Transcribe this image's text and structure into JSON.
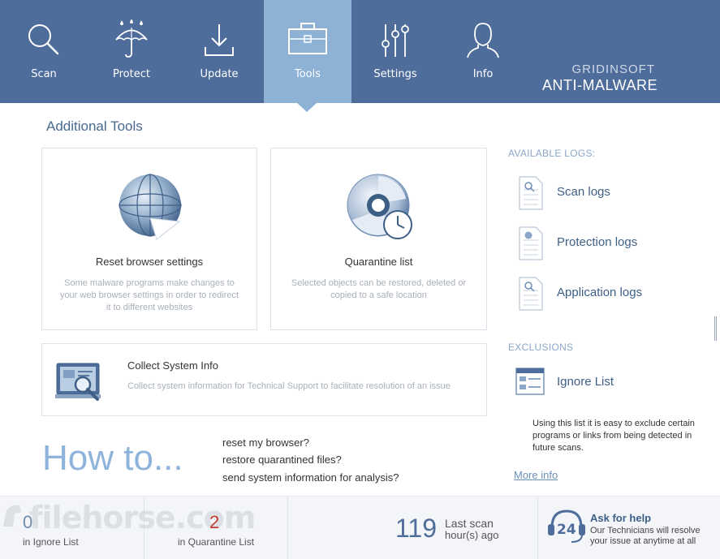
{
  "nav": {
    "items": [
      {
        "label": "Scan",
        "icon": "search-icon"
      },
      {
        "label": "Protect",
        "icon": "umbrella-icon"
      },
      {
        "label": "Update",
        "icon": "download-icon"
      },
      {
        "label": "Tools",
        "icon": "toolbox-icon",
        "active": true
      },
      {
        "label": "Settings",
        "icon": "sliders-icon"
      },
      {
        "label": "Info",
        "icon": "person-icon"
      }
    ]
  },
  "brand": {
    "top": "GRIDINSOFT",
    "bottom": "ANTI-MALWARE"
  },
  "page_title": "Additional Tools",
  "tools": {
    "reset": {
      "title": "Reset browser settings",
      "desc": "Some malware programs make changes to your web browser settings in order to redirect it to different websites",
      "icon": "globe-icon"
    },
    "quarantine": {
      "title": "Quarantine list",
      "desc": "Selected objects can be restored, deleted or copied to a safe location",
      "icon": "quarantine-disc-icon"
    },
    "collect": {
      "title": "Collect System Info",
      "desc": "Collect system information for Technical Support to facilitate resolution of an issue",
      "icon": "system-info-icon"
    }
  },
  "logs": {
    "label": "AVAILABLE LOGS:",
    "items": [
      "Scan logs",
      "Protection logs",
      "Application logs"
    ]
  },
  "exclusions": {
    "label": "EXCLUSIONS",
    "ignore_list": "Ignore List",
    "note": "Using this list it is easy to exclude certain programs or links from being detected in future scans.",
    "more_info": "More info"
  },
  "howto": {
    "title": "How to...",
    "links": [
      "reset my browser?",
      "restore quarantined files?",
      "send system information for analysis?"
    ]
  },
  "status": {
    "ignore_count": "0",
    "ignore_label": "in Ignore List",
    "quarantine_count": "2",
    "quarantine_label": "in Quarantine List",
    "last_scan_value": "119",
    "last_scan_label": "Last scan",
    "last_scan_unit": "hour(s) ago",
    "help_badge": "24",
    "help_title": "Ask for help",
    "help_text": "Our Technicians will resolve your issue at anytime at all"
  },
  "watermark": "filehorse.com",
  "colors": {
    "nav_bg": "#4e6d9b",
    "nav_active": "#8eb1d6",
    "accent": "#3d5f86",
    "quarantine_count": "#c0392b"
  }
}
